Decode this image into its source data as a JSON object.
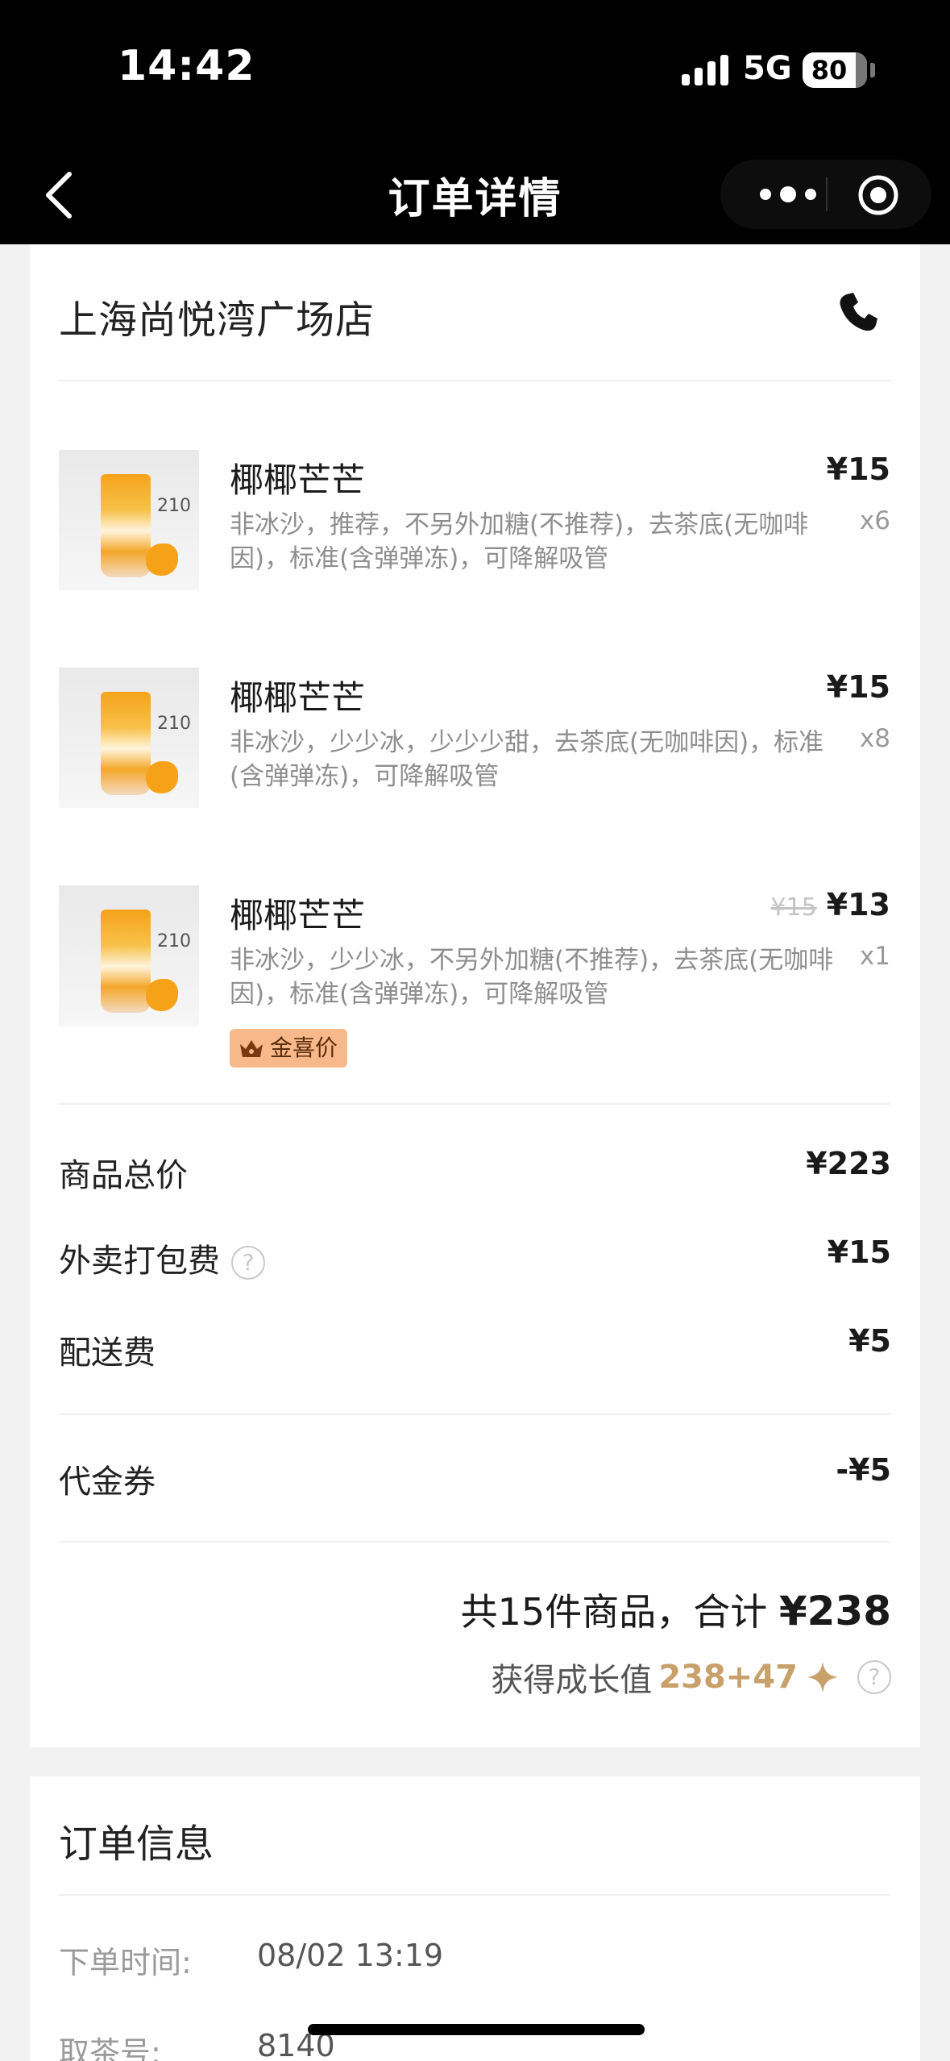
{
  "status_bar": {
    "time": "14:42",
    "network": "5G",
    "battery": "80"
  },
  "nav": {
    "title": "订单详情",
    "back_icon": "chevron-left-icon",
    "more_icon": "more-dots-icon",
    "close_icon": "target-icon"
  },
  "store": {
    "name": "上海尚悦湾广场店",
    "phone_icon": "phone-icon"
  },
  "items": [
    {
      "name": "椰椰芒芒",
      "desc": "非冰沙，推荐，不另外加糖(不推荐)，去茶底(无咖啡因)，标准(含弹弹冻)，可降解吸管",
      "price": "¥15",
      "old_price": "",
      "qty": "x6",
      "cup_label": "热量≈\n210\n大卡(参)"
    },
    {
      "name": "椰椰芒芒",
      "desc": "非冰沙，少少冰，少少少甜，去茶底(无咖啡因)，标准(含弹弹冻)，可降解吸管",
      "price": "¥15",
      "old_price": "",
      "qty": "x8",
      "cup_label": "热量≈\n210\n大卡(参)"
    },
    {
      "name": "椰椰芒芒",
      "desc": "非冰沙，少少冰，不另外加糖(不推荐)，去茶底(无咖啡因)，标准(含弹弹冻)，可降解吸管",
      "price": "¥13",
      "old_price": "¥15",
      "qty": "x1",
      "badge": "金喜价",
      "cup_label": "热量≈\n210\n大卡(参)"
    }
  ],
  "summary": {
    "goods_total_label": "商品总价",
    "goods_total": "¥223",
    "packing_label": "外卖打包费",
    "packing": "¥15",
    "delivery_label": "配送费",
    "delivery": "¥5",
    "voucher_label": "代金券",
    "voucher": "-¥5",
    "total_prefix": "共15件商品，合计",
    "total": "¥238",
    "growth_label": "获得成长值",
    "growth_value": "238+47",
    "help_symbol": "?"
  },
  "order_info": {
    "title": "订单信息",
    "time_label": "下单时间:",
    "time": "08/02 13:19",
    "number_label": "取茶号:",
    "number": "8140"
  },
  "colors": {
    "accent_gold": "#c8a06a",
    "badge_bg": "#f7b98a"
  }
}
